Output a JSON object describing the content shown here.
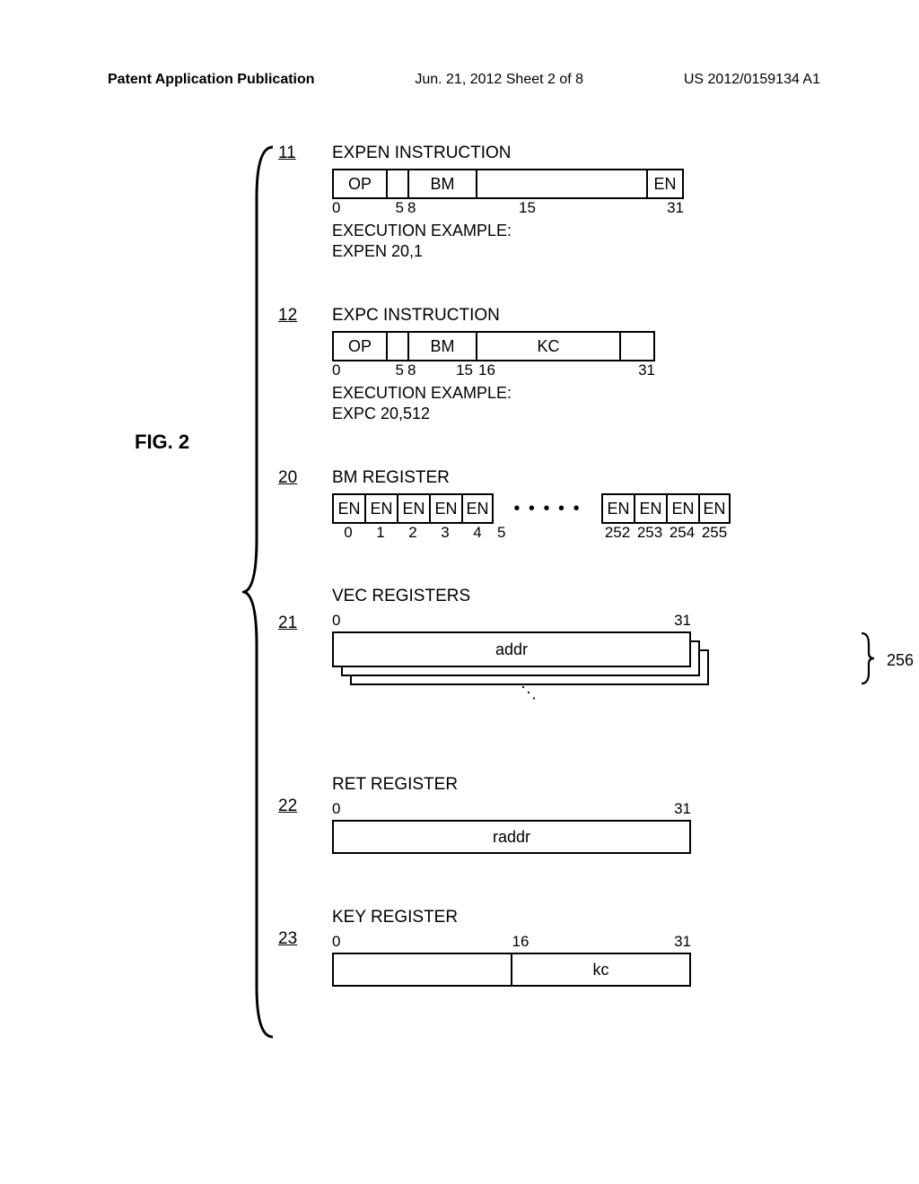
{
  "header": {
    "left": "Patent Application Publication",
    "mid": "Jun. 21, 2012  Sheet 2 of 8",
    "right": "US 2012/0159134 A1"
  },
  "figure_label": "FIG. 2",
  "items": {
    "expen": {
      "ref": "11",
      "title": "EXPEN INSTRUCTION",
      "cells": {
        "op": "OP",
        "bm": "BM",
        "en": "EN"
      },
      "ticks": {
        "t0": "0",
        "t5": "5",
        "t8": "8",
        "t15": "15",
        "t31": "31"
      },
      "example_label": "EXECUTION EXAMPLE:",
      "example_value": "EXPEN 20,1"
    },
    "expc": {
      "ref": "12",
      "title": "EXPC INSTRUCTION",
      "cells": {
        "op": "OP",
        "bm": "BM",
        "kc": "KC"
      },
      "ticks": {
        "t0": "0",
        "t5": "5",
        "t8": "8",
        "t15": "15",
        "t16": "16",
        "t31": "31"
      },
      "example_label": "EXECUTION EXAMPLE:",
      "example_value": "EXPC 20,512"
    },
    "bm": {
      "ref": "20",
      "title": "BM REGISTER",
      "en": "EN",
      "dots": "• • • • •",
      "ticks": {
        "t0": "0",
        "t1": "1",
        "t2": "2",
        "t3": "3",
        "t4": "4",
        "t5": "5",
        "t252": "252",
        "t253": "253",
        "t254": "254",
        "t255": "255"
      }
    },
    "vec": {
      "ref": "21",
      "title": "VEC REGISTERS",
      "ticks": {
        "t0": "0",
        "t31": "31"
      },
      "addr": "addr",
      "count": "256"
    },
    "ret": {
      "ref": "22",
      "title": "RET REGISTER",
      "ticks": {
        "t0": "0",
        "t31": "31"
      },
      "raddr": "raddr"
    },
    "key": {
      "ref": "23",
      "title": "KEY REGISTER",
      "ticks": {
        "t0": "0",
        "t16": "16",
        "t31": "31"
      },
      "kc": "kc"
    }
  }
}
